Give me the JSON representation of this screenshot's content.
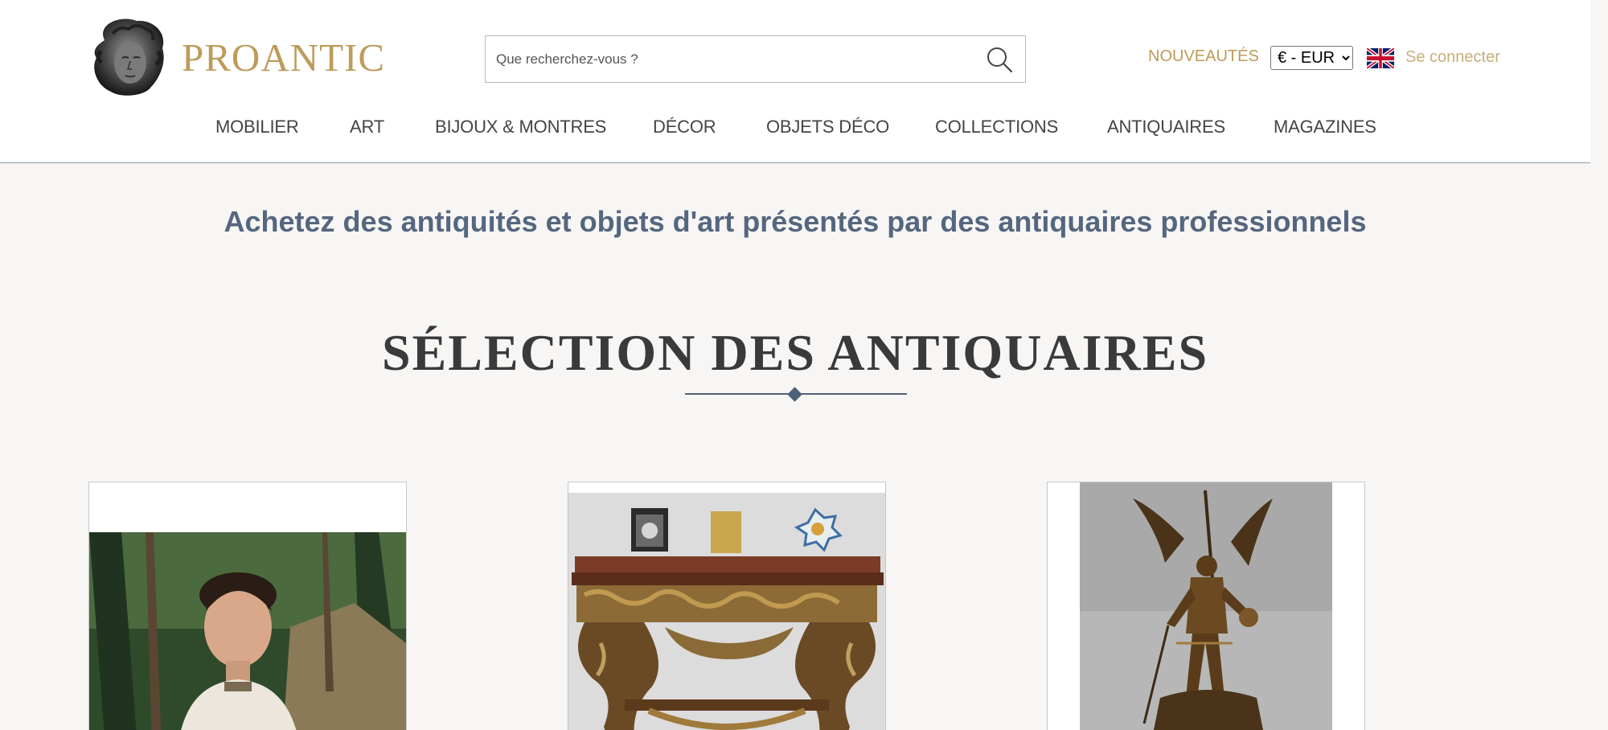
{
  "header": {
    "logo_text": "PROANTIC",
    "logo_icon": "sculpted-head-icon",
    "search": {
      "placeholder": "Que recherchez-vous ?",
      "icon": "search-icon"
    },
    "new_label": "NOUVEAUTÉS",
    "currency": {
      "selected": "€ - EUR",
      "options": [
        "€ - EUR"
      ]
    },
    "language_icon": "uk-flag-icon",
    "login_label": "Se connecter",
    "colors": {
      "accent": "#bd9b5a",
      "login": "#c9ae7c"
    }
  },
  "nav": {
    "items": [
      "MOBILIER",
      "ART",
      "BIJOUX & MONTRES",
      "DÉCOR",
      "OBJETS DÉCO",
      "COLLECTIONS",
      "ANTIQUAIRES",
      "MAGAZINES"
    ]
  },
  "main": {
    "tagline": "Achetez des antiquités et objets d'art présentés par des antiquaires professionnels",
    "section_title": "SÉLECTION DES ANTIQUAIRES",
    "products": [
      {
        "image": "portrait-painting-woman-in-forest"
      },
      {
        "image": "gilded-carved-console-table"
      },
      {
        "image": "bronze-winged-knight-statue"
      }
    ]
  }
}
